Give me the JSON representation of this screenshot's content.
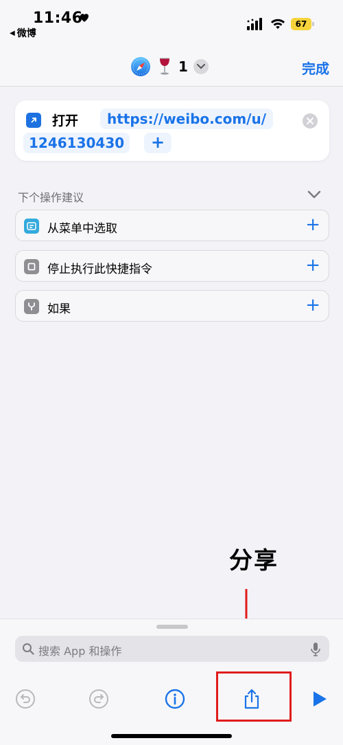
{
  "status_bar": {
    "time": "11:46",
    "back_app": "微博",
    "battery": "67"
  },
  "nav": {
    "title_count": "1",
    "done_label": "完成"
  },
  "action": {
    "verb": "打开",
    "url_part1": "https://weibo.com/u/",
    "url_part2": "1246130430",
    "add_symbol": "+"
  },
  "suggestions": {
    "header": "下个操作建议",
    "items": [
      {
        "label": "从菜单中选取",
        "plus": "+"
      },
      {
        "label": "停止执行此快捷指令",
        "plus": "+"
      },
      {
        "label": "如果",
        "plus": "+"
      }
    ]
  },
  "annotation": {
    "text": "分享"
  },
  "search": {
    "placeholder": "搜索 App 和操作"
  },
  "colors": {
    "accent": "#1a73e8",
    "annotation": "#e01b1b",
    "battery": "#f5d33a"
  }
}
